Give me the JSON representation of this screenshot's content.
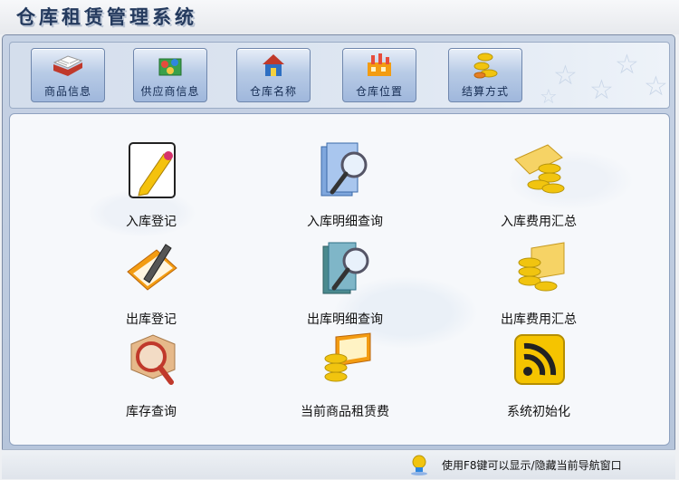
{
  "app": {
    "title": "仓库租赁管理系统"
  },
  "toolbar": {
    "buttons": [
      {
        "label": "商品信息",
        "icon": "book-icon"
      },
      {
        "label": "供应商信息",
        "icon": "suppliers-icon"
      },
      {
        "label": "仓库名称",
        "icon": "house-icon"
      },
      {
        "label": "仓库位置",
        "icon": "factory-icon"
      },
      {
        "label": "结算方式",
        "icon": "coins-icon"
      }
    ]
  },
  "main": {
    "tiles": [
      {
        "label": "入库登记",
        "icon": "pencil-paper-icon"
      },
      {
        "label": "入库明细查询",
        "icon": "magnifier-document-icon"
      },
      {
        "label": "入库费用汇总",
        "icon": "coins-card-icon"
      },
      {
        "label": "出库登记",
        "icon": "folder-pencil-icon"
      },
      {
        "label": "出库明细查询",
        "icon": "magnifier-folder-icon"
      },
      {
        "label": "出库费用汇总",
        "icon": "coins-laptop-icon"
      },
      {
        "label": "库存查询",
        "icon": "box-magnifier-icon"
      },
      {
        "label": "当前商品租赁费",
        "icon": "coins-notebook-icon"
      },
      {
        "label": "系统初始化",
        "icon": "rss-icon"
      }
    ]
  },
  "status": {
    "tip": "使用F8键可以显示/隐藏当前导航窗口"
  }
}
